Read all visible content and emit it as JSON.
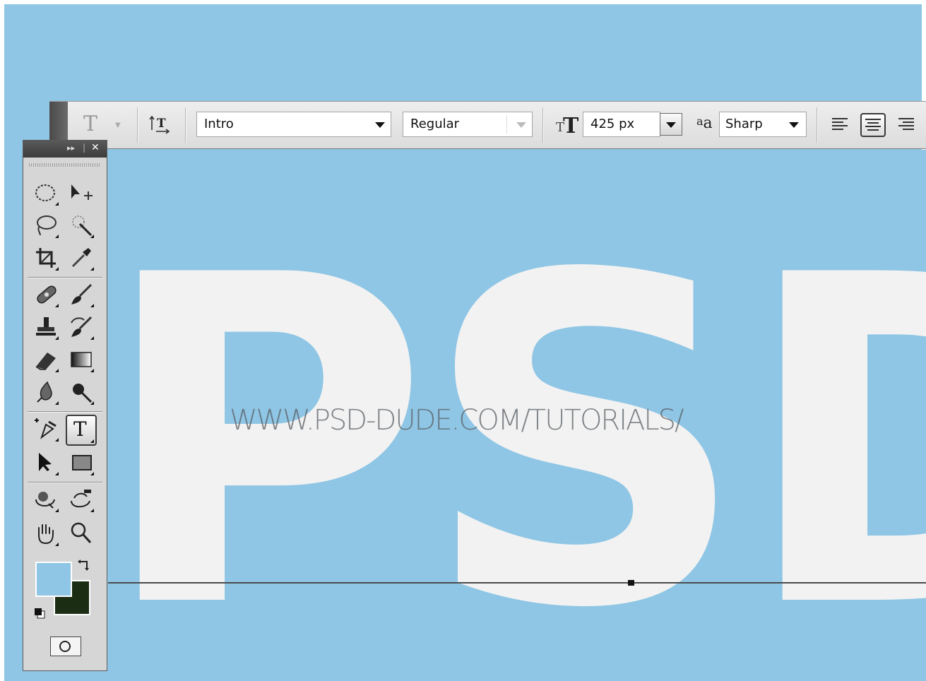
{
  "options_bar": {
    "tool_preset_glyph": "T",
    "font_family": "Intro",
    "font_style": "Regular",
    "font_size": "425 px",
    "anti_alias_label": "a",
    "anti_alias_label_large": "a",
    "anti_alias": "Sharp",
    "text_align": "center"
  },
  "canvas": {
    "big_text": "PSD",
    "watermark": "WWW.PSD-DUDE.COM/TUTORIALS/",
    "background_color": "#8fc6e5",
    "text_color": "#f2f2f2"
  },
  "tools_panel": {
    "collapse_glyph": "▸▸",
    "close_glyph": "✕",
    "selected_tool": "type-tool",
    "type_tool_glyph": "T",
    "foreground_color": "#8fc6e5",
    "background_color": "#1b2d13"
  }
}
